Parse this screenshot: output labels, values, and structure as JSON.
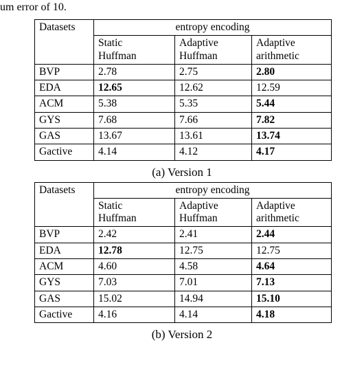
{
  "fragment_top": "um error of 10",
  "fragment_dot": ".",
  "header": {
    "datasets": "Datasets",
    "group": "entropy encoding",
    "col1a": "Static",
    "col1b": "Huffman",
    "col2a": "Adaptive",
    "col2b": "Huffman",
    "col3a": "Adaptive",
    "col3b": "arithmetic"
  },
  "table_a": {
    "caption": "(a) Version 1",
    "rows": [
      {
        "name": "BVP",
        "c1": "2.78",
        "c2": "2.75",
        "c3": "2.80",
        "bold": [
          3
        ]
      },
      {
        "name": "EDA",
        "c1": "12.65",
        "c2": "12.62",
        "c3": "12.59",
        "bold": [
          1
        ]
      },
      {
        "name": "ACM",
        "c1": "5.38",
        "c2": "5.35",
        "c3": "5.44",
        "bold": [
          3
        ]
      },
      {
        "name": "GYS",
        "c1": "7.68",
        "c2": "7.66",
        "c3": "7.82",
        "bold": [
          3
        ]
      },
      {
        "name": "GAS",
        "c1": "13.67",
        "c2": "13.61",
        "c3": "13.74",
        "bold": [
          3
        ]
      },
      {
        "name": "Gactive",
        "c1": "4.14",
        "c2": "4.12",
        "c3": "4.17",
        "bold": [
          3
        ]
      }
    ]
  },
  "table_b": {
    "caption": "(b) Version 2",
    "rows": [
      {
        "name": "BVP",
        "c1": "2.42",
        "c2": "2.41",
        "c3": "2.44",
        "bold": [
          3
        ]
      },
      {
        "name": "EDA",
        "c1": "12.78",
        "c2": "12.75",
        "c3": "12.75",
        "bold": [
          1
        ]
      },
      {
        "name": "ACM",
        "c1": "4.60",
        "c2": "4.58",
        "c3": "4.64",
        "bold": [
          3
        ]
      },
      {
        "name": "GYS",
        "c1": "7.03",
        "c2": "7.01",
        "c3": "7.13",
        "bold": [
          3
        ]
      },
      {
        "name": "GAS",
        "c1": "15.02",
        "c2": "14.94",
        "c3": "15.10",
        "bold": [
          3
        ]
      },
      {
        "name": "Gactive",
        "c1": "4.16",
        "c2": "4.14",
        "c3": "4.18",
        "bold": [
          3
        ]
      }
    ]
  },
  "chart_data": [
    {
      "type": "table",
      "title": "(a) Version 1 — entropy encoding",
      "categories": [
        "BVP",
        "EDA",
        "ACM",
        "GYS",
        "GAS",
        "Gactive"
      ],
      "series": [
        {
          "name": "Static Huffman",
          "values": [
            2.78,
            12.65,
            5.38,
            7.68,
            13.67,
            4.14
          ]
        },
        {
          "name": "Adaptive Huffman",
          "values": [
            2.75,
            12.62,
            5.35,
            7.66,
            13.61,
            4.12
          ]
        },
        {
          "name": "Adaptive arithmetic",
          "values": [
            2.8,
            12.59,
            5.44,
            7.82,
            13.74,
            4.17
          ]
        }
      ]
    },
    {
      "type": "table",
      "title": "(b) Version 2 — entropy encoding",
      "categories": [
        "BVP",
        "EDA",
        "ACM",
        "GYS",
        "GAS",
        "Gactive"
      ],
      "series": [
        {
          "name": "Static Huffman",
          "values": [
            2.42,
            12.78,
            4.6,
            7.03,
            15.02,
            4.16
          ]
        },
        {
          "name": "Adaptive Huffman",
          "values": [
            2.41,
            12.75,
            4.58,
            7.01,
            14.94,
            4.14
          ]
        },
        {
          "name": "Adaptive arithmetic",
          "values": [
            2.44,
            12.75,
            4.64,
            7.13,
            15.1,
            4.18
          ]
        }
      ]
    }
  ]
}
